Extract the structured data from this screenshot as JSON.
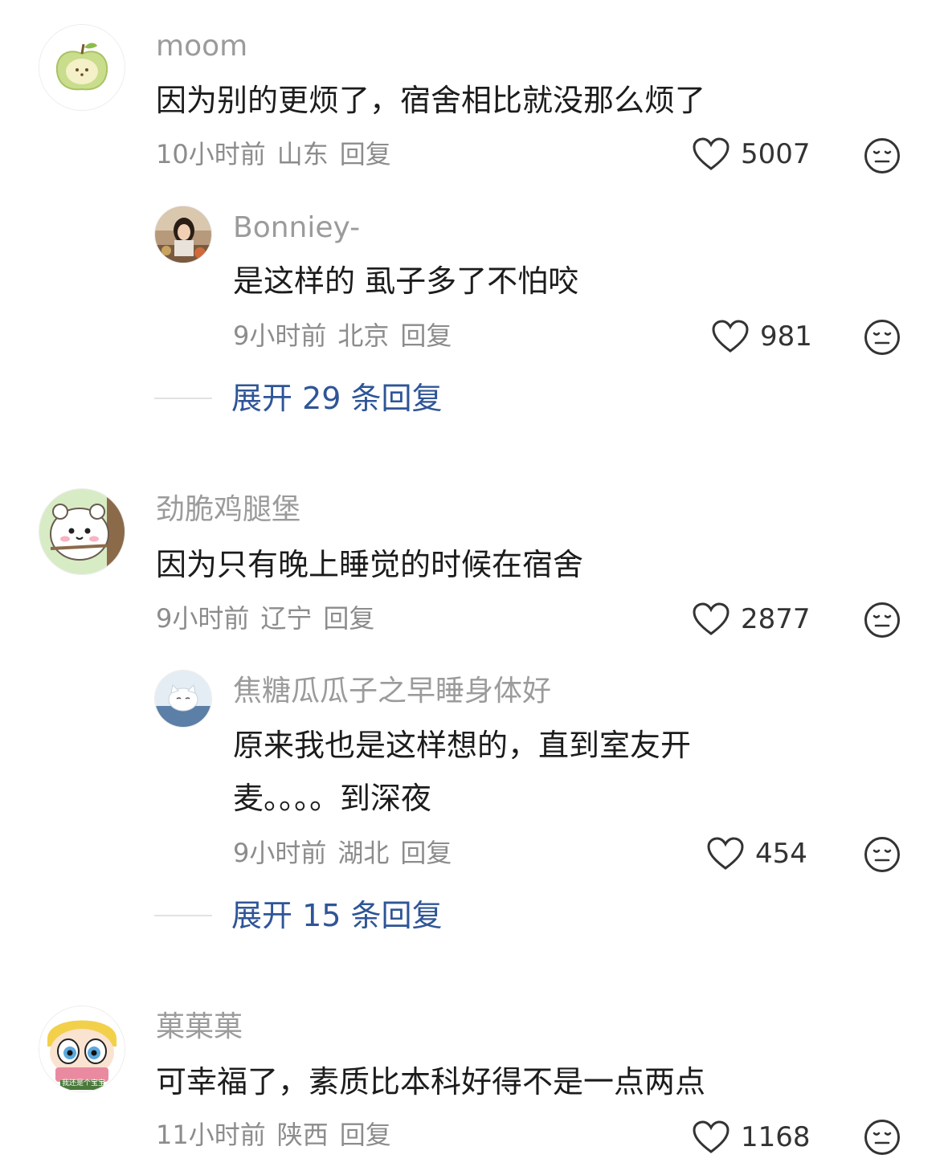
{
  "comments": [
    {
      "username": "moom",
      "text": "因为别的更烦了，宿舍相比就没那么烦了",
      "time": "10小时前",
      "location": "山东",
      "reply_label": "回复",
      "likes": "5007",
      "sub_reply": {
        "username": "Bonniey-",
        "text": "是这样的 虱子多了不怕咬",
        "time": "9小时前",
        "location": "北京",
        "reply_label": "回复",
        "likes": "981"
      },
      "expand_label": "展开 29 条回复"
    },
    {
      "username": "劲脆鸡腿堡",
      "text": "因为只有晚上睡觉的时候在宿舍",
      "time": "9小时前",
      "location": "辽宁",
      "reply_label": "回复",
      "likes": "2877",
      "sub_reply": {
        "username": "焦糖瓜瓜子之早睡身体好",
        "text_line1": "原来我也是这样想的，直到室友开",
        "text_line2": "麦。。。。到深夜",
        "time": "9小时前",
        "location": "湖北",
        "reply_label": "回复",
        "likes": "454"
      },
      "expand_label": "展开 15 条回复"
    },
    {
      "username": "菓菓菓",
      "text": "可幸福了，素质比本科好得不是一点两点",
      "time": "11小时前",
      "location": "陕西",
      "reply_label": "回复",
      "likes": "1168",
      "avatar_caption": "我还是个宝宝"
    }
  ],
  "icons": {
    "like": "heart-outline-icon",
    "dislike": "expressionless-face-icon"
  },
  "colors": {
    "link": "#2f5597",
    "meta": "#8c8c8c",
    "username": "#9b9b9b"
  }
}
